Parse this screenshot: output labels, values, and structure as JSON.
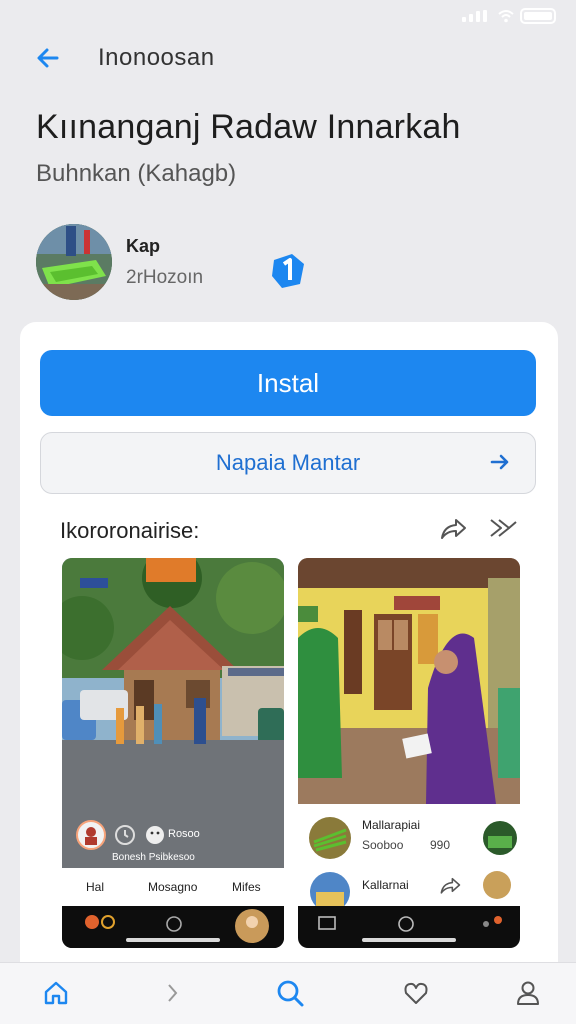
{
  "header": {
    "title": "Inonoosan"
  },
  "app": {
    "title": "Kıınanganj Radaw Innarkah",
    "subtitle": "Buhnkan (Kahagb)",
    "developer_name": "Kap",
    "developer_meta": "2rHozoın"
  },
  "actions": {
    "install_label": "Instal",
    "secondary_label": "Napaia Mantar"
  },
  "screenshots_section": {
    "title": "Ikororonairise:"
  },
  "screenshot1": {
    "stat_label": "Rosoo",
    "stat_caption": "Bonesh Psibkesoo",
    "tabs": [
      "Hal",
      "Mosagno",
      "Mifes"
    ]
  },
  "screenshot2": {
    "items": [
      {
        "title": "Mallarapiai",
        "sub": "Sooboo",
        "count": "990"
      },
      {
        "title": "Kallarnai"
      }
    ]
  },
  "colors": {
    "accent": "#1d87f0",
    "link": "#1f6fd1",
    "background": "#ebebee"
  },
  "icons": {
    "back": "arrow-left-icon",
    "badge": "verified-badge-icon",
    "share": "share-icon",
    "forward": "forward-icon",
    "home": "home-icon",
    "chevron": "chevron-right-icon",
    "search": "search-icon",
    "favorites": "heart-icon",
    "profile": "person-icon"
  }
}
